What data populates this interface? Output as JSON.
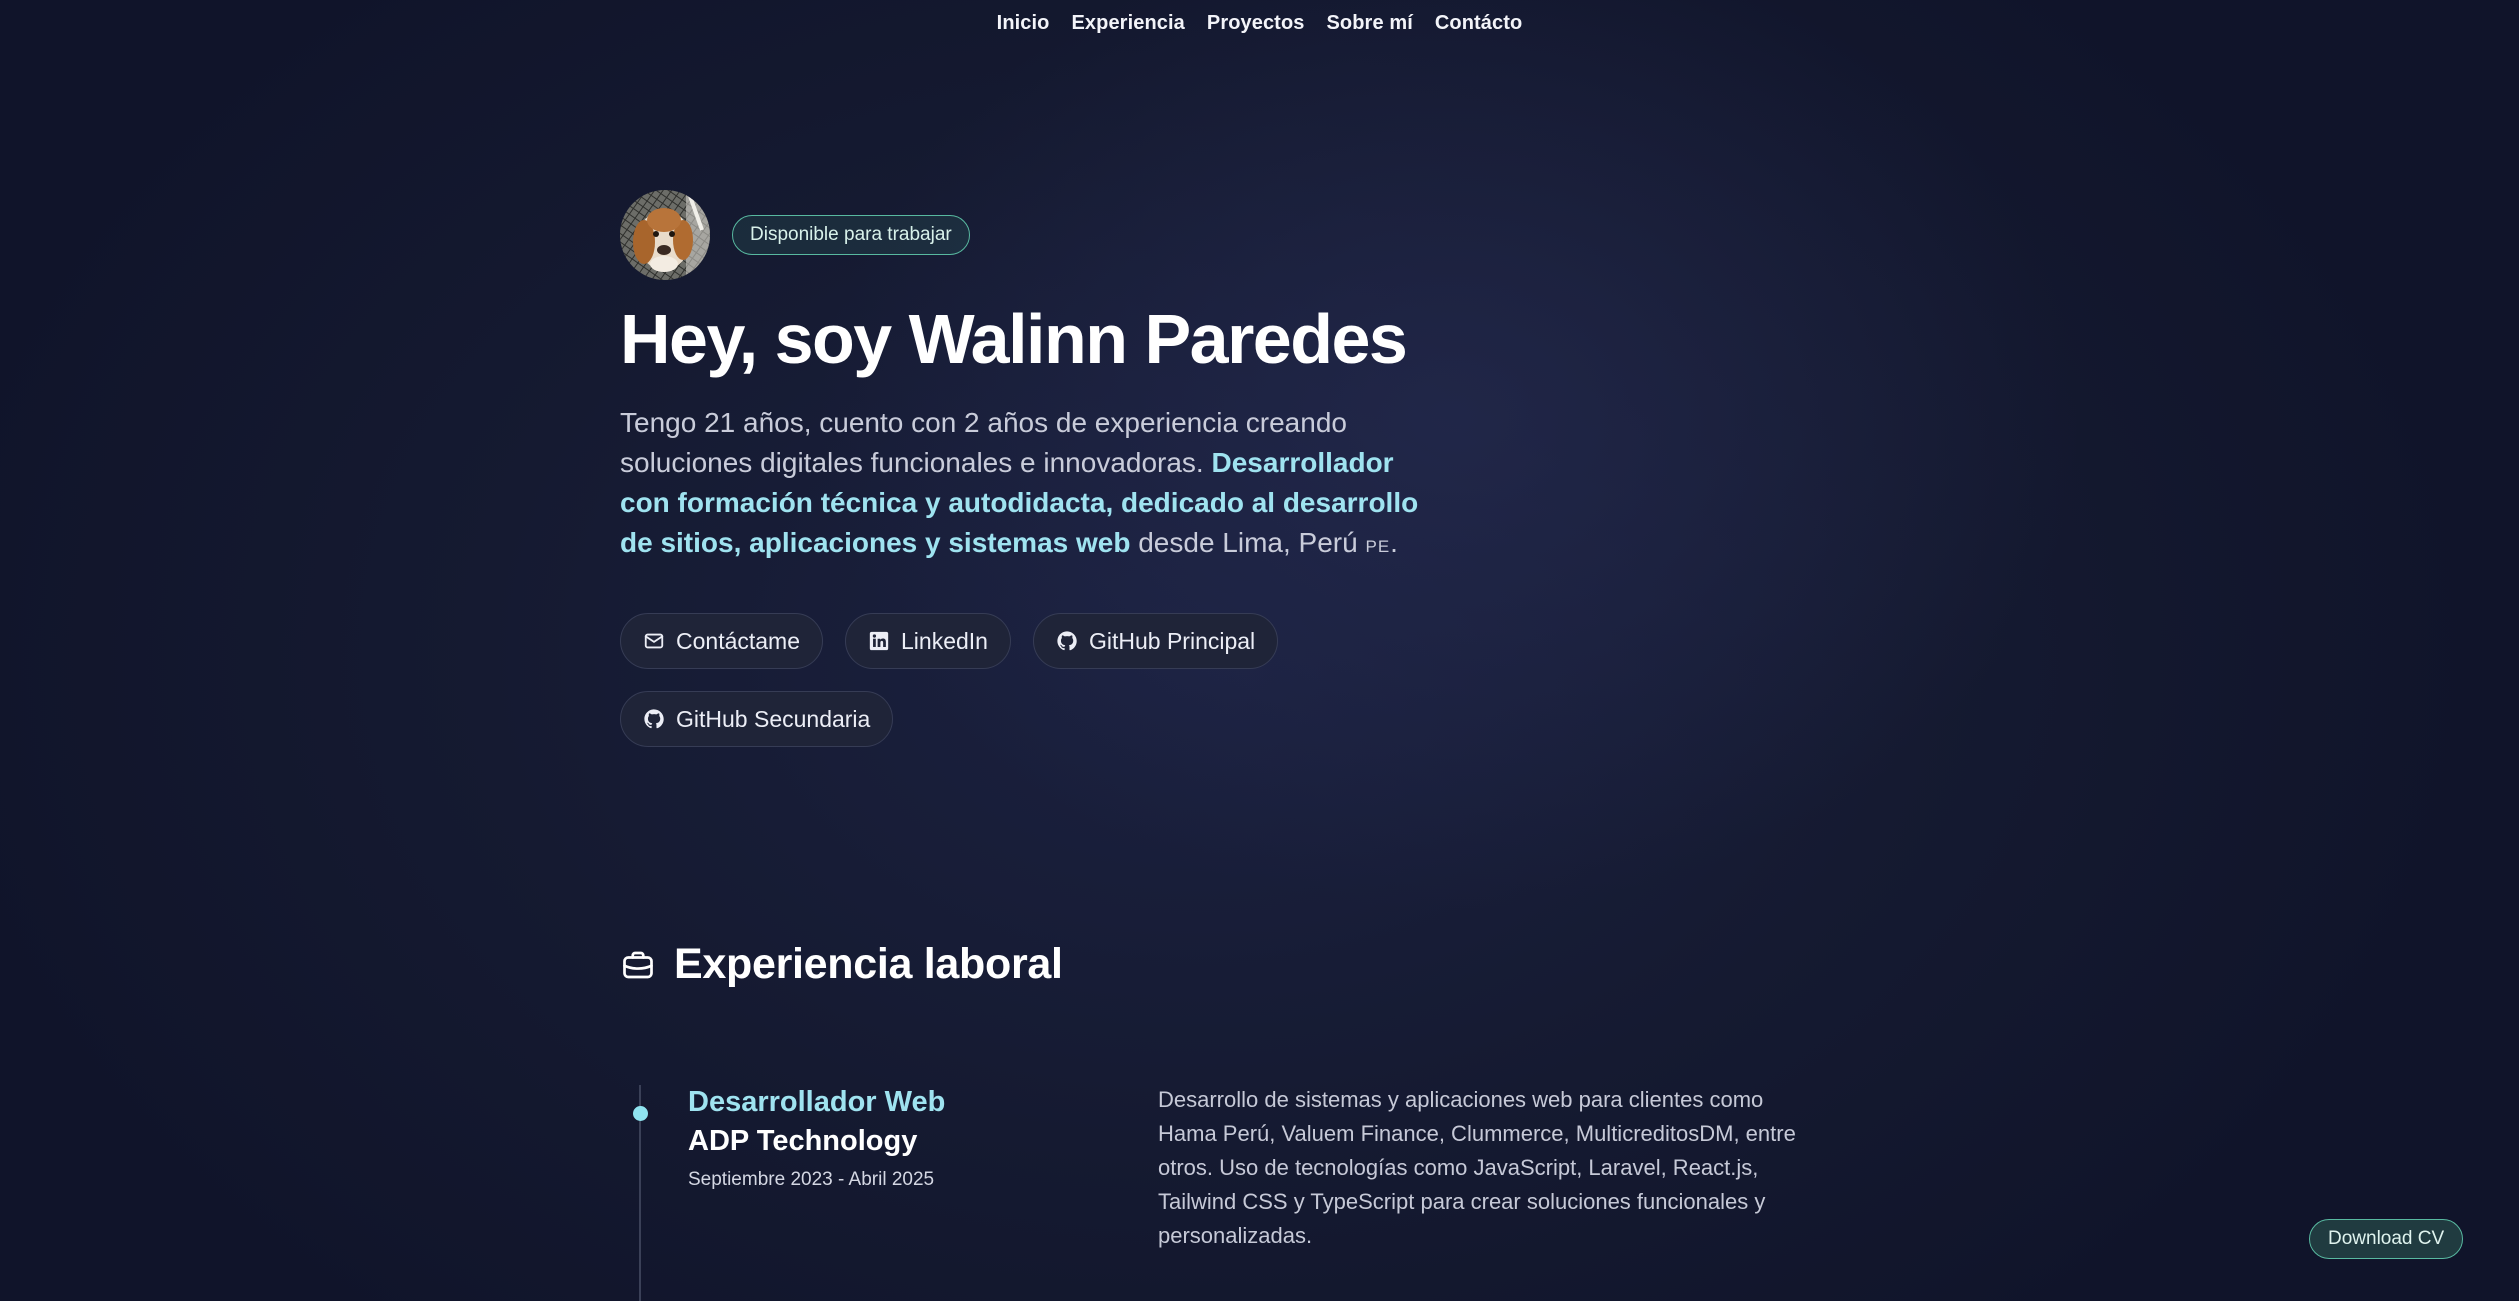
{
  "nav": {
    "items": [
      {
        "label": "Inicio"
      },
      {
        "label": "Experiencia"
      },
      {
        "label": "Proyectos"
      },
      {
        "label": "Sobre mí"
      },
      {
        "label": "Contácto"
      }
    ]
  },
  "hero": {
    "avatar_icon": "dog-photo-avatar",
    "badge": "Disponible para trabajar",
    "title": "Hey, soy Walinn Paredes",
    "intro": {
      "text_before": "Tengo 21 años, cuento con 2 años de experiencia creando soluciones digitales funcionales e innovadoras.",
      "highlight": "Desarrollador con formación técnica y autodidacta, dedicado al desarrollo de sitios, aplicaciones y sistemas web",
      "text_after": "desde Lima, Perú",
      "flag": "PE",
      "end": "."
    },
    "buttons": [
      {
        "label": "Contáctame",
        "icon": "mail-icon"
      },
      {
        "label": "LinkedIn",
        "icon": "linkedin-icon"
      },
      {
        "label": "GitHub Principal",
        "icon": "github-icon"
      },
      {
        "label": "GitHub Secundaria",
        "icon": "github-icon"
      }
    ]
  },
  "experience": {
    "heading": "Experiencia laboral",
    "heading_icon": "briefcase-icon",
    "jobs": [
      {
        "role": "Desarrollador Web",
        "company": "ADP Technology",
        "dates": "Septiembre 2023 - Abril 2025",
        "description": "Desarrollo de sistemas y aplicaciones web para clientes como Hama Perú, Valuem Finance, Clummerce, MulticreditosDM, entre otros. Uso de tecnologías como JavaScript, Laravel, React.js, Tailwind CSS y TypeScript para crear soluciones funcionales y personalizadas."
      }
    ]
  },
  "download_cv": "Download CV",
  "colors": {
    "background": "#151a31",
    "accent_cyan": "#9fe3f0",
    "accent_green": "#58b9a0",
    "text": "#e7e9f2"
  }
}
